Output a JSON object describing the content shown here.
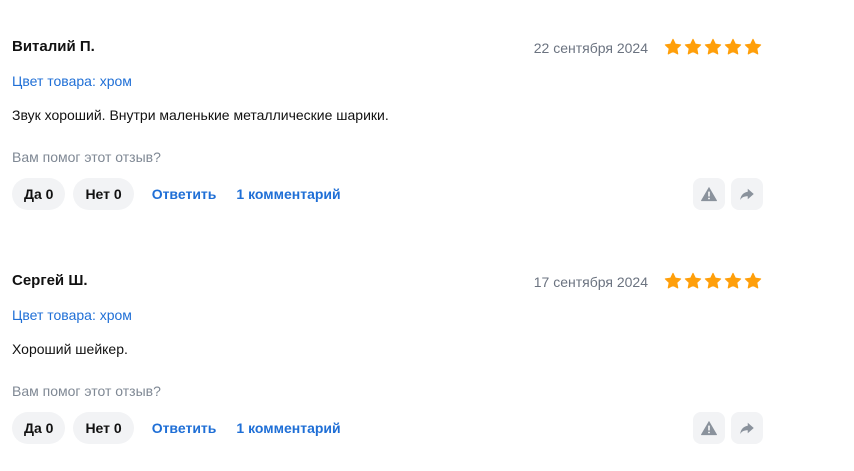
{
  "colors": {
    "accent_link": "#1f6fd6",
    "star": "#ff9f0a",
    "muted_text": "#7f8894",
    "pill_background": "#f2f3f5",
    "icon": "#8a929c"
  },
  "icons": [
    "star-icon",
    "warning-icon",
    "share-arrow-icon"
  ],
  "reviews": [
    {
      "author": "Виталий П.",
      "date": "22 сентября 2024",
      "rating": 5,
      "variant": "Цвет товара: хром",
      "text": "Звук хороший. Внутри маленькие металлические шарики.",
      "helpful_prompt": "Вам помог этот отзыв?",
      "yes_label": "Да 0",
      "no_label": "Нет 0",
      "reply_label": "Ответить",
      "comments_label": "1 комментарий"
    },
    {
      "author": "Сергей Ш.",
      "date": "17 сентября 2024",
      "rating": 5,
      "variant": "Цвет товара: хром",
      "text": "Хороший шейкер.",
      "helpful_prompt": "Вам помог этот отзыв?",
      "yes_label": "Да 0",
      "no_label": "Нет 0",
      "reply_label": "Ответить",
      "comments_label": "1 комментарий"
    }
  ]
}
